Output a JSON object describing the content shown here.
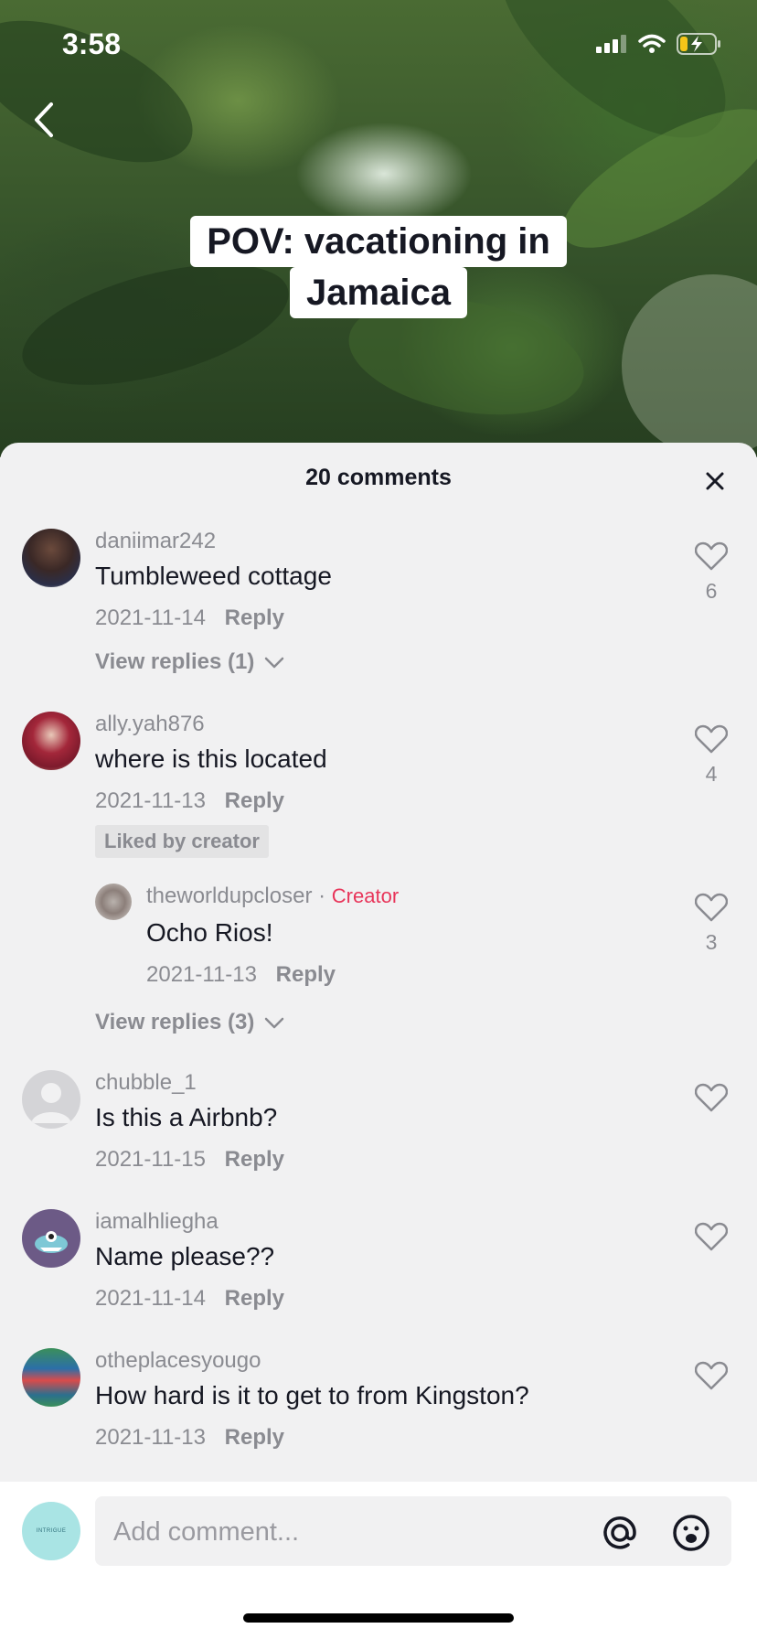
{
  "status_bar": {
    "time": "3:58"
  },
  "video": {
    "caption_line1": "POV: vacationing in",
    "caption_line2": "Jamaica"
  },
  "sheet": {
    "title": "20 comments",
    "reply_label": "Reply",
    "creator_label": "Creator",
    "liked_by_creator": "Liked by creator"
  },
  "comments": [
    {
      "username": "daniimar242",
      "text": "Tumbleweed cottage",
      "date": "2021-11-14",
      "likes": "6",
      "view_replies": "View replies (1)"
    },
    {
      "username": "ally.yah876",
      "text": "where is this located",
      "date": "2021-11-13",
      "likes": "4"
    },
    {
      "username": "theworldupcloser",
      "text": "Ocho Rios!",
      "date": "2021-11-13",
      "likes": "3",
      "view_replies": "View replies (3)"
    },
    {
      "username": "chubble_1",
      "text": "Is this a Airbnb?",
      "date": "2021-11-15"
    },
    {
      "username": "iamalhliegha",
      "text": "Name please??",
      "date": "2021-11-14"
    },
    {
      "username": "otheplacesyougo",
      "text": "How hard is it to get to from Kingston?",
      "date": "2021-11-13"
    }
  ],
  "footer": {
    "placeholder": "Add comment...",
    "avatar_text": "INTRIGUE"
  },
  "colors": {
    "accent_creator": "#e8355a",
    "secondary_text": "#8a8b91",
    "primary_text": "#161823"
  }
}
